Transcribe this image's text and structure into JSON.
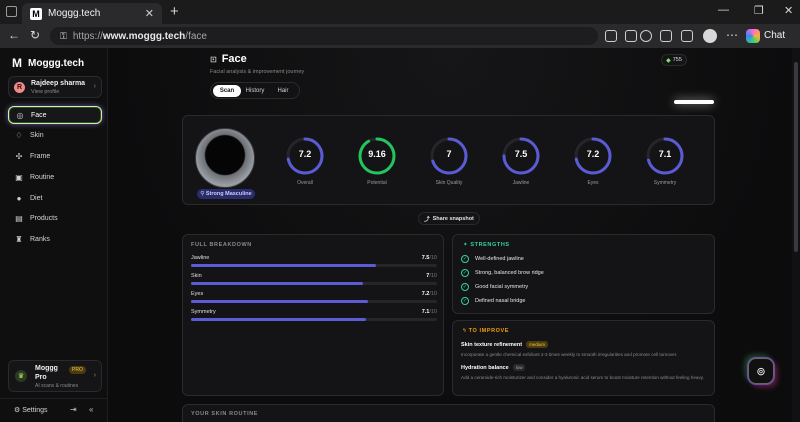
{
  "browser": {
    "tab_title": "Moggg.tech",
    "tab_close": "✕",
    "new_tab": "+",
    "url_prefix": "https://",
    "url_host": "www.moggg.tech",
    "url_path": "/face",
    "chat_label": "Chat",
    "win_min": "—",
    "win_max": "❐",
    "win_close": "✕"
  },
  "sidebar": {
    "brand": "Moggg.tech",
    "profile_initial": "R",
    "profile_name": "Rajdeep sharma",
    "profile_sub": "View profile",
    "items": [
      {
        "label": "Face",
        "icon": "face-scan-icon",
        "glyph": "◎"
      },
      {
        "label": "Skin",
        "icon": "droplet-icon",
        "glyph": "♢"
      },
      {
        "label": "Frame",
        "icon": "dumbbell-icon",
        "glyph": "✣"
      },
      {
        "label": "Routine",
        "icon": "calendar-icon",
        "glyph": "▣"
      },
      {
        "label": "Diet",
        "icon": "apple-icon",
        "glyph": "●"
      },
      {
        "label": "Products",
        "icon": "box-icon",
        "glyph": "▤"
      },
      {
        "label": "Ranks",
        "icon": "trophy-icon",
        "glyph": "♜"
      }
    ],
    "pro": {
      "title_1": "Moggg",
      "title_2": "Pro",
      "badge": "PRO",
      "sub": "AI scans & routines"
    },
    "settings": "Settings"
  },
  "header": {
    "title": "Face",
    "subtitle": "Facial analysis & improvement journey",
    "tabs": [
      "Scan",
      "History",
      "Hair"
    ],
    "active_tab": "Scan",
    "streak": "755"
  },
  "scores": {
    "photo_tag": "Strong Masculine",
    "accent_colors": {
      "default": "#5b5bd6",
      "potential": "#22c55e"
    },
    "rings": [
      {
        "label": "Overall",
        "value": "7.2"
      },
      {
        "label": "Potential",
        "value": "9.16"
      },
      {
        "label": "Skin Quality",
        "value": "7"
      },
      {
        "label": "Jawline",
        "value": "7.5"
      },
      {
        "label": "Eyes",
        "value": "7.2"
      },
      {
        "label": "Symmetry",
        "value": "7.1"
      }
    ]
  },
  "share_label": "Share snapshot",
  "breakdown": {
    "title": "FULL BREAKDOWN",
    "out_of": "/10",
    "rows": [
      {
        "label": "Jawline",
        "score": "7.5"
      },
      {
        "label": "Skin",
        "score": "7"
      },
      {
        "label": "Eyes",
        "score": "7.2"
      },
      {
        "label": "Symmetry",
        "score": "7.1"
      }
    ]
  },
  "strengths": {
    "title": "STRENGTHS",
    "items": [
      "Well-defined jawline",
      "Strong, balanced brow ridge",
      "Good facial symmetry",
      "Defined nasal bridge"
    ]
  },
  "improve": {
    "title": "TO IMPROVE",
    "items": [
      {
        "title": "Skin texture refinement",
        "tag": "medium",
        "desc": "Incorporate a gentle chemical exfoliant 2-3 times weekly to smooth irregularities and promote cell turnover."
      },
      {
        "title": "Hydration balance",
        "tag": "low",
        "desc": "Add a ceramide-rich moisturizer and consider a hyaluronic acid serum to boost moisture retention without feeling heavy."
      }
    ]
  },
  "routine": {
    "title": "YOUR SKIN ROUTINE"
  }
}
